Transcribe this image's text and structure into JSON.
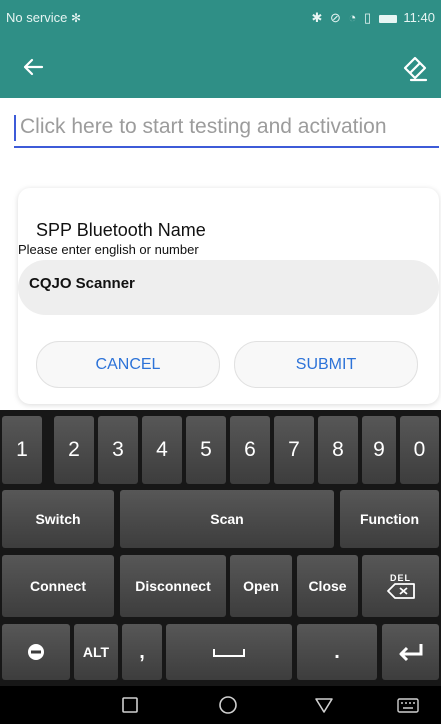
{
  "status_bar": {
    "carrier": "No service",
    "time": "11:40"
  },
  "toolbar": {
    "back_icon": "back-arrow-icon",
    "eraser_icon": "eraser-icon"
  },
  "test_area": {
    "placeholder": "Click here to start testing and activation"
  },
  "dialog": {
    "title": "SPP Bluetooth Name",
    "hint": "Please enter english or number",
    "name_value": "CQJO Scanner",
    "cancel_label": "CANCEL",
    "submit_label": "SUBMIT"
  },
  "keyboard": {
    "numbers": [
      "1",
      "2",
      "3",
      "4",
      "5",
      "6",
      "7",
      "8",
      "9",
      "0"
    ],
    "switch_label": "Switch",
    "scan_label": "Scan",
    "function_label": "Function",
    "connect_label": "Connect",
    "disconnect_label": "Disconnect",
    "open_label": "Open",
    "close_label": "Close",
    "del_label": "DEL",
    "alt_label": "ALT",
    "comma_label": ",",
    "period_label": "."
  },
  "colors": {
    "toolbar": "#2f8f86",
    "accent": "#3d5bd8",
    "button_text": "#2d73d8",
    "keyboard_bg": "#171717"
  }
}
